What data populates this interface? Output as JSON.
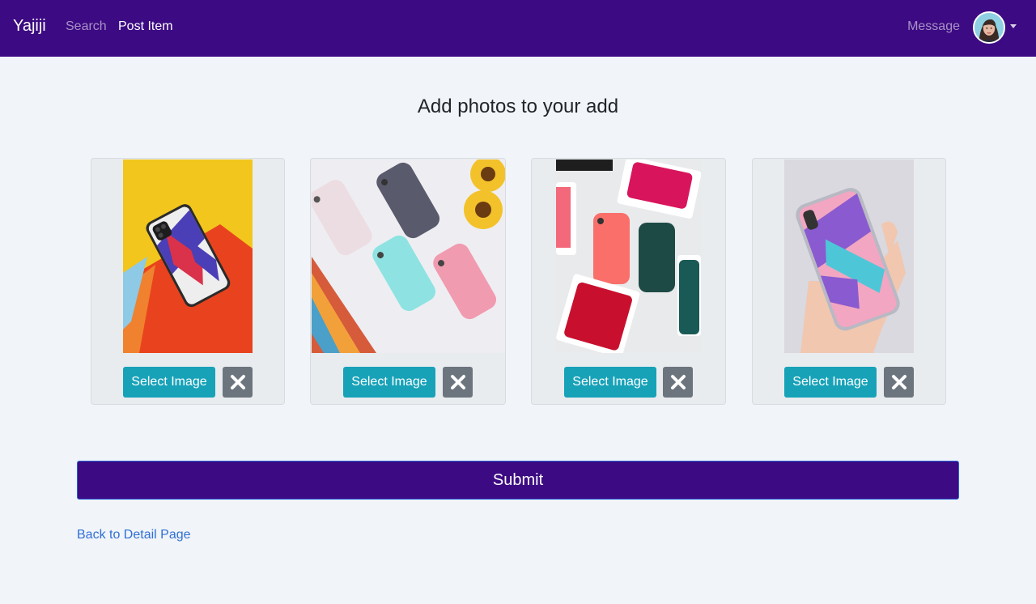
{
  "nav": {
    "brand": "Yajiji",
    "search": "Search",
    "post_item": "Post Item",
    "message": "Message"
  },
  "main": {
    "title": "Add photos to your add",
    "photos": [
      {
        "select_label": "Select Image"
      },
      {
        "select_label": "Select Image"
      },
      {
        "select_label": "Select Image"
      },
      {
        "select_label": "Select Image"
      }
    ],
    "submit_label": "Submit",
    "back_link": "Back to Detail Page"
  },
  "colors": {
    "navbar": "#3c0a82",
    "select_button": "#17a2b8",
    "remove_button": "#6c757d",
    "link": "#2f6fd6"
  }
}
